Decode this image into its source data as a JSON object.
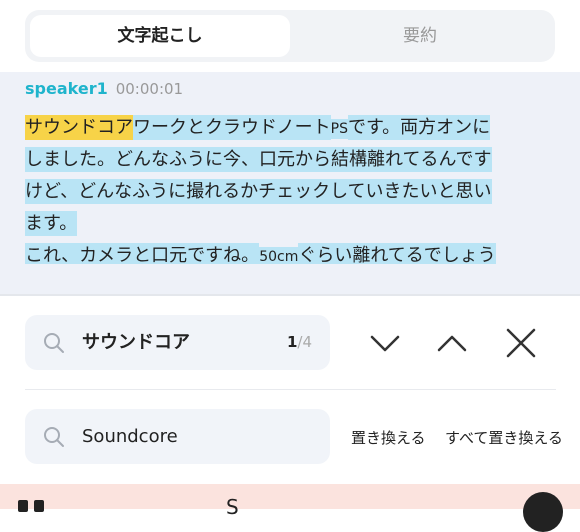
{
  "tabs": {
    "transcription": "文字起こし",
    "summary": "要約"
  },
  "transcript": {
    "speaker": "speaker1",
    "timestamp": "00:00:01",
    "line1_hit": "サウンドコア",
    "line1_rest_a": "ワークとクラウドノート",
    "line1_ps": "PS",
    "line1_rest_b": "です。両方オンに",
    "line2": "しました。どんなふうに今、口元から結構離れてるんです",
    "line3": "けど、どんなふうに撮れるかチェックしていきたいと思い",
    "line4": "ます。",
    "line5_a": "これ、カメラと口元ですね。",
    "line5_cm": "50cm",
    "line5_b": "ぐらい離れてるでしょう"
  },
  "search": {
    "value": "サウンドコア",
    "current": "1",
    "separator": "/",
    "total": "4"
  },
  "replace": {
    "value": "Soundcore",
    "replace_label": "置き換える",
    "replace_all_label": "すべて置き換える"
  },
  "bottom": {
    "center_text": "S"
  },
  "colors": {
    "accent": "#1fb4cc",
    "highlight": "#f7d348",
    "selection": "#b9e4f5",
    "bottom_bar": "#fbe3de"
  },
  "icons": {
    "search": "search-icon",
    "next": "chevron-down-icon",
    "prev": "chevron-up-icon",
    "close": "close-icon"
  }
}
